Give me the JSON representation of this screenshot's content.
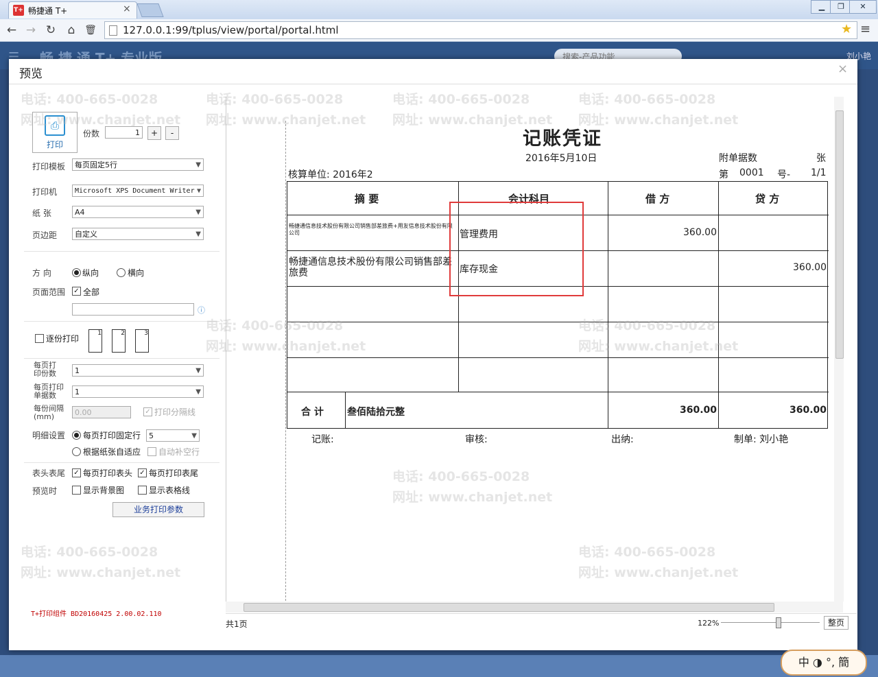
{
  "browser": {
    "tab_title": "畅捷通 T+",
    "tab_logo": "T+",
    "url": "127.0.0.1:99/tplus/view/portal/portal.html"
  },
  "app": {
    "logo": "畅 捷 通 T+ 专业版",
    "search_placeholder": "搜索-产品功能",
    "user": "刘小艳"
  },
  "dialog": {
    "title": "预览",
    "close": "×"
  },
  "left": {
    "print_label": "打印",
    "copies_label": "份数",
    "copies_value": "1",
    "plus": "+",
    "minus": "-",
    "template_label": "打印模板",
    "template_value": "每页固定5行",
    "printer_label": "打印机",
    "printer_value": "Microsoft XPS Document Writer",
    "paper_label": "纸  张",
    "paper_value": "A4",
    "margin_label": "页边距",
    "margin_value": "自定义",
    "orient_label": "方  向",
    "portrait": "纵向",
    "landscape": "横向",
    "range_label": "页面范围",
    "range_all": "全部",
    "collate_label": "逐份打印",
    "pages_per_label": "每页打印份数",
    "pages_per_value": "1",
    "docs_per_label": "每页打印单据数",
    "docs_per_value": "1",
    "gap_label": "每份间隔(mm)",
    "gap_value": "0.00",
    "print_sep": "打印分隔线",
    "detail_label": "明细设置",
    "fixed_rows": "每页打印固定行",
    "fixed_rows_value": "5",
    "adapt_rows": "根据纸张自适应",
    "auto_fill": "自动补空行",
    "header_footer_label": "表头表尾",
    "print_header": "每页打印表头",
    "print_footer": "每页打印表尾",
    "preview_label": "预览时",
    "show_bg": "显示背景图",
    "show_grid": "显示表格线",
    "biz_params": "业务打印参数",
    "version": "T+打印组件 BD20160425 2.00.02.110"
  },
  "voucher": {
    "title": "记账凭证",
    "date": "2016年5月10日",
    "attach_label": "附单据数",
    "attach_unit": "张",
    "unit_label": "核算单位: 2016年2",
    "no_label": "第",
    "no_value": "0001",
    "no_suffix": "号-",
    "page": "1/1",
    "headers": [
      "摘  要",
      "会计科目",
      "借  方",
      "贷  方"
    ],
    "rows": [
      {
        "summary": "畅捷通信息技术股份有限公司销售部差旅费+用友信息技术股份有限公司",
        "account": "管理费用",
        "debit": "360.00",
        "credit": ""
      },
      {
        "summary": "畅捷通信息技术股份有限公司销售部差旅费",
        "account": "库存现金",
        "debit": "",
        "credit": "360.00"
      },
      {
        "summary": "",
        "account": "",
        "debit": "",
        "credit": ""
      },
      {
        "summary": "",
        "account": "",
        "debit": "",
        "credit": ""
      },
      {
        "summary": "",
        "account": "",
        "debit": "",
        "credit": ""
      }
    ],
    "total_label": "合  计",
    "total_words": "叁佰陆拾元整",
    "total_debit": "360.00",
    "total_credit": "360.00",
    "bookkeeper": "记账:",
    "reviewer": "审核:",
    "cashier": "出纳:",
    "preparer": "制单: 刘小艳"
  },
  "status": {
    "pages": "共1页",
    "zoom": "122%",
    "fit": "整页"
  },
  "watermark": {
    "phone": "电话: 400-665-0028",
    "site": "网址: www.chanjet.net"
  },
  "ime": "中 ◑ °, 簡",
  "colors": {
    "highlight": "#e03a3a",
    "version_red": "#c00000"
  }
}
